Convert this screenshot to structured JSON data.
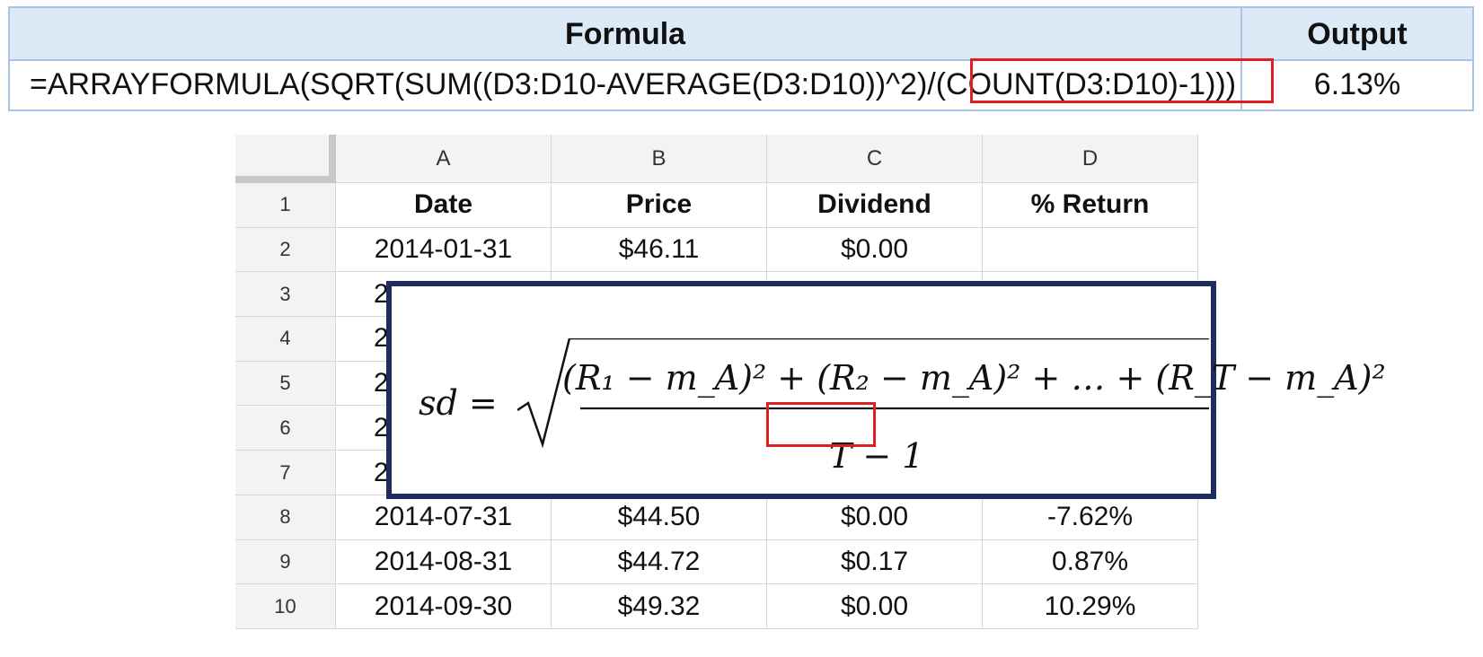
{
  "formula_table": {
    "headers": {
      "formula": "Formula",
      "output": "Output"
    },
    "formula": "=ARRAYFORMULA(SQRT(SUM((D3:D10-AVERAGE(D3:D10))^2)/(COUNT(D3:D10)-1)))",
    "output": "6.13%"
  },
  "sheet": {
    "columns": [
      "A",
      "B",
      "C",
      "D"
    ],
    "row_numbers": [
      "1",
      "2",
      "3",
      "4",
      "5",
      "6",
      "7",
      "8",
      "9",
      "10"
    ],
    "header_row": [
      "Date",
      "Price",
      "Dividend",
      "% Return"
    ],
    "rows": [
      [
        "2014-01-31",
        "$46.11",
        "$0.00",
        ""
      ],
      [
        "2",
        "",
        "",
        ""
      ],
      [
        "2",
        "",
        "",
        ""
      ],
      [
        "2",
        "",
        "",
        ""
      ],
      [
        "2",
        "",
        "",
        ""
      ],
      [
        "2",
        "",
        "",
        ""
      ],
      [
        "2014-07-31",
        "$44.50",
        "$0.00",
        "-7.62%"
      ],
      [
        "2014-08-31",
        "$44.72",
        "$0.17",
        "0.87%"
      ],
      [
        "2014-09-30",
        "$49.32",
        "$0.00",
        "10.29%"
      ]
    ]
  },
  "equation": {
    "lhs": "sd =",
    "numerator": "(R₁ − m_A)² + (R₂ − m_A)² +  … +  (R_T − m_A)²",
    "denominator": "T − 1"
  },
  "colors": {
    "highlight": "#e02020",
    "equation_border": "#1f2d5c",
    "header_bg": "#dce9f7"
  }
}
